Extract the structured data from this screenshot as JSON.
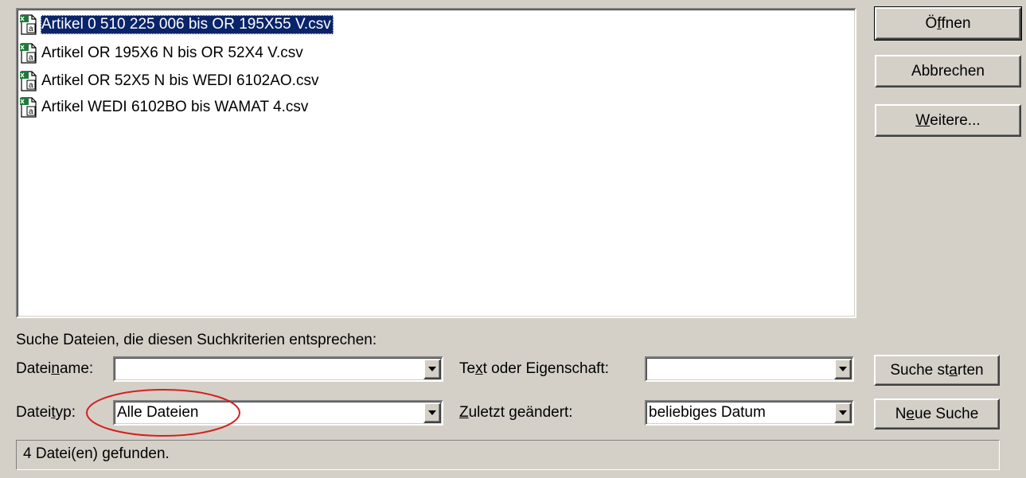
{
  "files": [
    {
      "name": "Artikel 0 510 225 006 bis OR 195X55 V.csv",
      "selected": true
    },
    {
      "name": "Artikel OR 195X6 N bis OR 52X4 V.csv",
      "selected": false
    },
    {
      "name": "Artikel OR 52X5 N bis WEDI 6102AO.csv",
      "selected": false
    },
    {
      "name": "Artikel WEDI 6102BO bis WAMAT 4.csv",
      "selected": false
    }
  ],
  "buttons": {
    "open": {
      "pre": "Ö",
      "u": "f",
      "post": "fnen"
    },
    "cancel": "Abbrechen",
    "more": {
      "u": "W",
      "post": "eitere..."
    },
    "search_start": {
      "pre": "Suche st",
      "u": "a",
      "post": "rten"
    },
    "new_search": {
      "pre": "N",
      "u": "e",
      "post": "ue Suche"
    }
  },
  "criteria": {
    "heading": "Suche Dateien, die diesen Suchkriterien entsprechen:",
    "filename_label": {
      "pre": "Datei",
      "u": "n",
      "post": "ame:"
    },
    "filename_value": "",
    "filetype_label": {
      "pre": "Datei",
      "u": "t",
      "post": "yp:"
    },
    "filetype_value": "Alle Dateien",
    "text_label": {
      "pre": "Te",
      "u": "x",
      "post": "t oder Eigenschaft:"
    },
    "text_value": "",
    "modified_label": {
      "u": "Z",
      "post": "uletzt geändert:"
    },
    "modified_value": "beliebiges Datum"
  },
  "status": "4 Datei(en) gefunden.",
  "colors": {
    "selection": "#0a246a",
    "highlight_circle": "#d42020",
    "face": "#d4d0c8"
  },
  "icons": {
    "file": "csv-file-icon",
    "dropdown": "dropdown-arrow-icon"
  }
}
